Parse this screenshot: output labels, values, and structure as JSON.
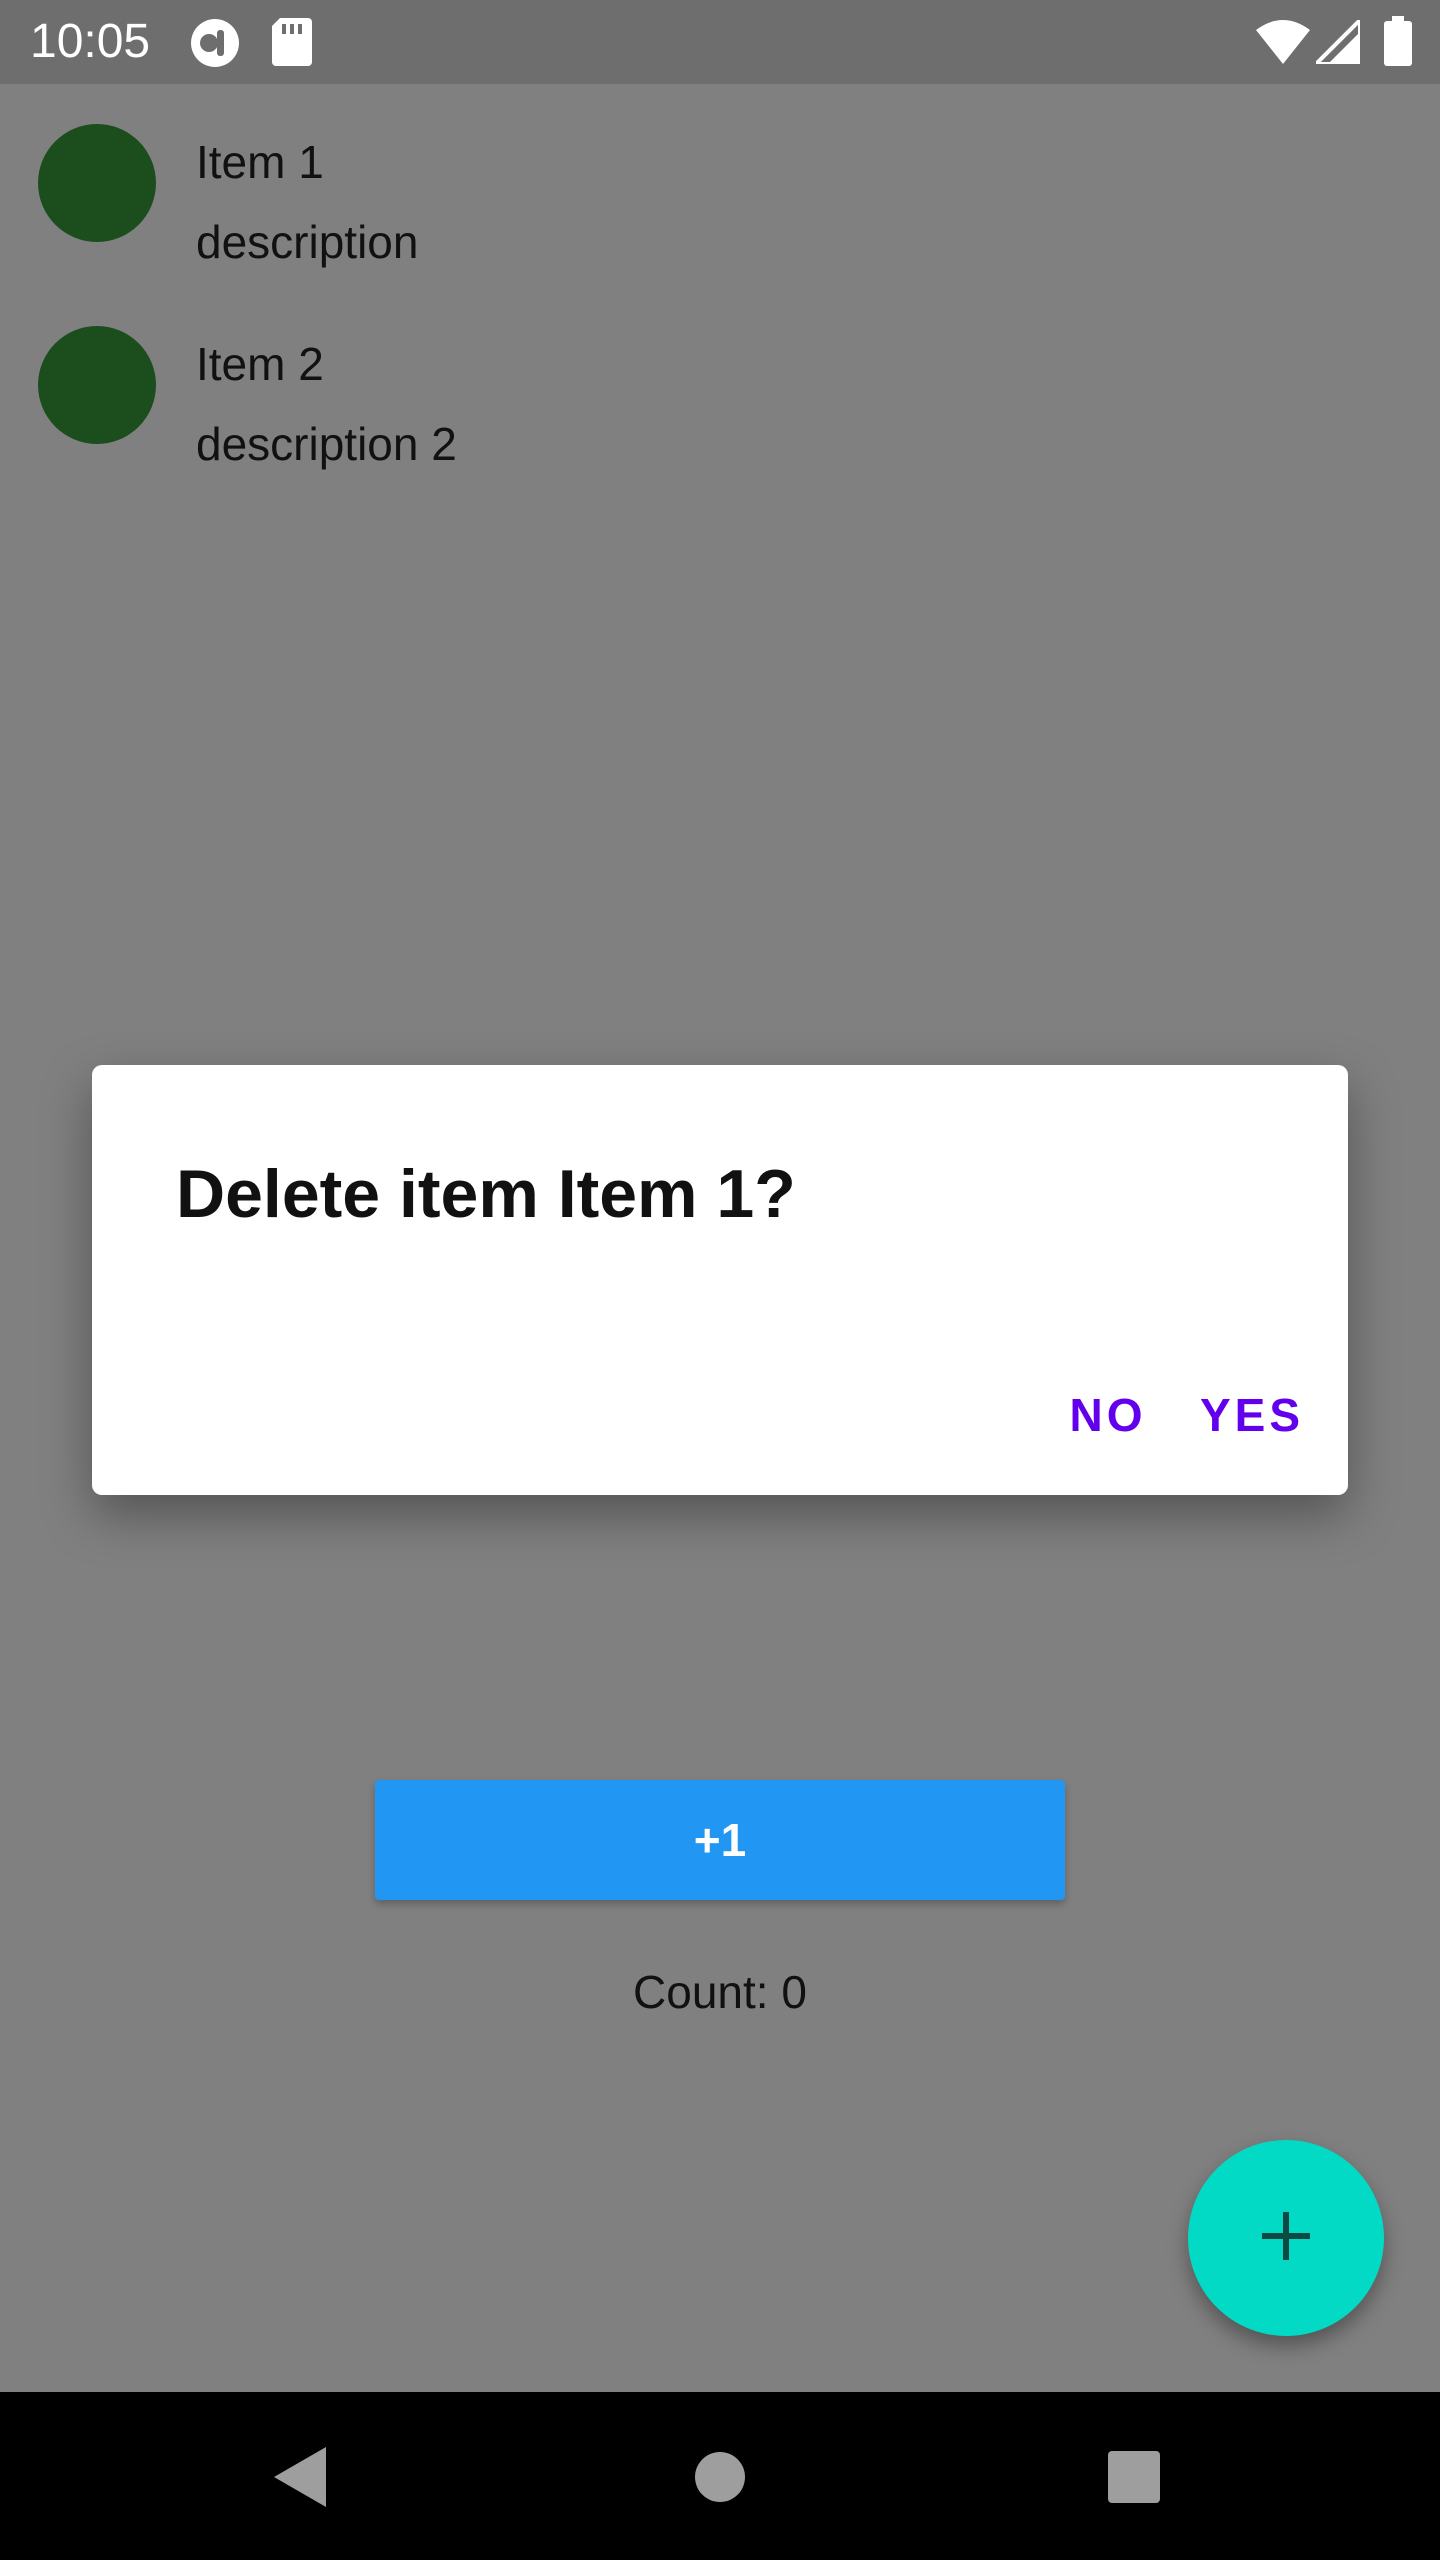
{
  "status_bar": {
    "time": "10:05",
    "icons": [
      "app-notification-icon",
      "sd-card-icon",
      "wifi-icon",
      "cell-signal-icon",
      "battery-icon"
    ]
  },
  "list": {
    "items": [
      {
        "title": "Item 1",
        "description": "description"
      },
      {
        "title": "Item 2",
        "description": "description 2"
      }
    ]
  },
  "main": {
    "increment_label": "+1",
    "count_text": "Count: 0"
  },
  "dialog": {
    "title": "Delete item Item 1?",
    "no_label": "NO",
    "yes_label": "YES"
  },
  "colors": {
    "scrim": "#808080",
    "avatar": "#1c4d1d",
    "primary_button": "#2196f3",
    "fab": "#03dac5",
    "dialog_action": "#6200ee"
  },
  "nav_bar": {
    "icons": [
      "back-icon",
      "home-icon",
      "recents-icon"
    ]
  }
}
